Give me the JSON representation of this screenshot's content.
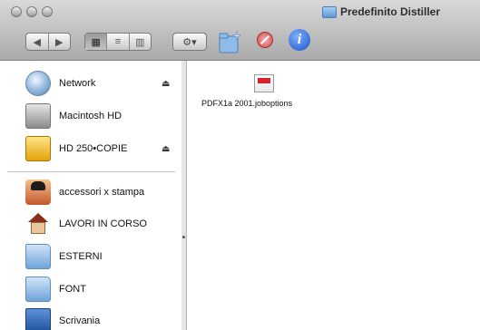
{
  "window": {
    "title": "Predefinito Distiller"
  },
  "toolbar": {
    "nav": {
      "back": "◀",
      "forward": "▶"
    },
    "view_modes": [
      "icon-view",
      "list-view",
      "column-view"
    ],
    "view_glyphs": [
      "▦",
      "≡",
      "▥"
    ],
    "action_label": "⚙▾",
    "info_label": "i"
  },
  "sidebar": {
    "items": [
      {
        "label": "Network",
        "icon": "network-globe-icon",
        "eject": "⏏"
      },
      {
        "label": "Macintosh HD",
        "icon": "hard-drive-icon"
      },
      {
        "label": "HD 250•COPIE",
        "icon": "external-drive-icon",
        "eject": "⏏"
      },
      {
        "label": "accessori x stampa",
        "icon": "user-home-icon"
      },
      {
        "label": "LAVORI IN CORSO",
        "icon": "house-icon"
      },
      {
        "label": "ESTERNI",
        "icon": "folder-icon"
      },
      {
        "label": "FONT",
        "icon": "folder-icon"
      },
      {
        "label": "Scrivania",
        "icon": "desktop-icon"
      }
    ]
  },
  "main": {
    "files": [
      {
        "name": "PDFX1a 2001.joboptions",
        "icon": "joboptions-file-icon"
      }
    ]
  },
  "colors": {
    "titlebar": "#c4c4c4",
    "folder": "#6fa3d8",
    "info_button": "#1d4fc4"
  }
}
